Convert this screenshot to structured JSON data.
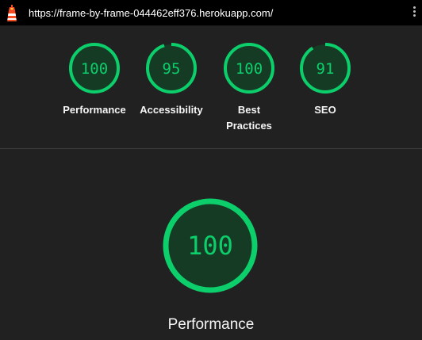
{
  "header": {
    "url": "https://frame-by-frame-044462eff376.herokuapp.com/",
    "logo_icon": "lighthouse-icon",
    "menu_icon": "kebab-menu-icon"
  },
  "summary": {
    "gauges": [
      {
        "score": "100",
        "score_value": 100,
        "label": "Performance"
      },
      {
        "score": "95",
        "score_value": 95,
        "label": "Accessibility"
      },
      {
        "score": "100",
        "score_value": 100,
        "label": "Best Practices"
      },
      {
        "score": "91",
        "score_value": 91,
        "label": "SEO"
      }
    ]
  },
  "detail": {
    "score": "100",
    "score_value": 100,
    "label": "Performance"
  },
  "colors": {
    "pass": "#0cce6b",
    "pass_bg": "#163b25",
    "background": "#212121",
    "text": "#f5f5f5"
  }
}
